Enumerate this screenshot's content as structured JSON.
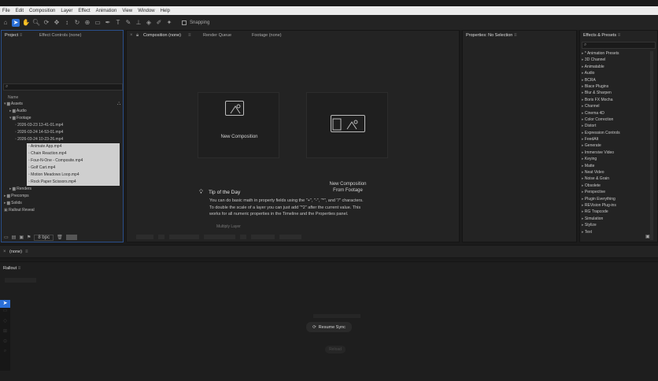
{
  "menu": [
    "File",
    "Edit",
    "Composition",
    "Layer",
    "Effect",
    "Animation",
    "View",
    "Window",
    "Help"
  ],
  "toolbar": {
    "snapping_label": "Snapping"
  },
  "project": {
    "tabs": [
      "Project",
      "Effect Controls (none)"
    ],
    "column_name": "Name",
    "tree": [
      {
        "label": "Assets",
        "level": 0,
        "type": "folder",
        "open": true
      },
      {
        "label": "Audio",
        "level": 1,
        "type": "folder",
        "open": false
      },
      {
        "label": "Footage",
        "level": 1,
        "type": "folder",
        "open": true
      },
      {
        "label": "2026-03-23 13-41-01.mp4",
        "level": 2,
        "type": "file"
      },
      {
        "label": "2026-03-24 14-53-01.mp4",
        "level": 2,
        "type": "file"
      },
      {
        "label": "2026-03-24 10-23-26.mp4",
        "level": 2,
        "type": "file"
      },
      {
        "label": "Animate App.mp4",
        "level": 2,
        "type": "file",
        "highlight": true
      },
      {
        "label": "Chain Reaction.mp4",
        "level": 2,
        "type": "file",
        "highlight": true
      },
      {
        "label": "Four-N-One - Composite.mp4",
        "level": 2,
        "type": "file",
        "highlight": true
      },
      {
        "label": "Golf Cart.mp4",
        "level": 2,
        "type": "file",
        "highlight": true
      },
      {
        "label": "Motion Meadows Loop.mp4",
        "level": 2,
        "type": "file",
        "highlight": true
      },
      {
        "label": "Rock Paper Scissors.mp4",
        "level": 2,
        "type": "file",
        "highlight": true
      },
      {
        "label": "Renders",
        "level": 1,
        "type": "folder",
        "open": false
      },
      {
        "label": "Precomps",
        "level": 0,
        "type": "folder",
        "open": false
      },
      {
        "label": "Solids",
        "level": 0,
        "type": "folder",
        "open": false
      },
      {
        "label": "Rallout Reveal",
        "level": 0,
        "type": "comp"
      }
    ],
    "bpc": "8 bpc"
  },
  "composition": {
    "tabs": [
      "Composition (none)",
      "Render Queue",
      "Footage (none)"
    ],
    "new_comp": "New Composition",
    "new_comp_footage_1": "New Composition",
    "new_comp_footage_2": "From Footage",
    "tip_title": "Tip of the Day",
    "tip_lines": [
      "You can do basic math in property fields using the \"+\", \"-\", \"*\", and \"/\" characters.",
      "To double the scale of a layer you can just add \"*2\" after the current value. This",
      "works for all numeric properties in the Timeline and the Properties panel."
    ],
    "tip_more": "Multiply Layer"
  },
  "properties": {
    "title": "Properties: No Selection"
  },
  "effects": {
    "title": "Effects & Presets",
    "items": [
      "* Animation Presets",
      "3D Channel",
      "Animatable",
      "Audio",
      "BCRA",
      "Blace Plugins",
      "Blur & Sharpen",
      "Boris FX Mocha",
      "Channel",
      "Cinema 4D",
      "Color Correction",
      "Distort",
      "Expression Controls",
      "FeedAlt",
      "Generate",
      "Immersive Video",
      "Keying",
      "Matte",
      "Neat Video",
      "Noise & Grain",
      "Obsolete",
      "Perspective",
      "Plugin Everything",
      "REVision Plug-ins",
      "RG Trapcode",
      "Simulation",
      "Stylize",
      "Text"
    ]
  },
  "timeline": {
    "tab": "(none)"
  },
  "rallout": {
    "title": "Rallout",
    "resume_label": "Resume Sync",
    "faint_label": "Reload"
  }
}
